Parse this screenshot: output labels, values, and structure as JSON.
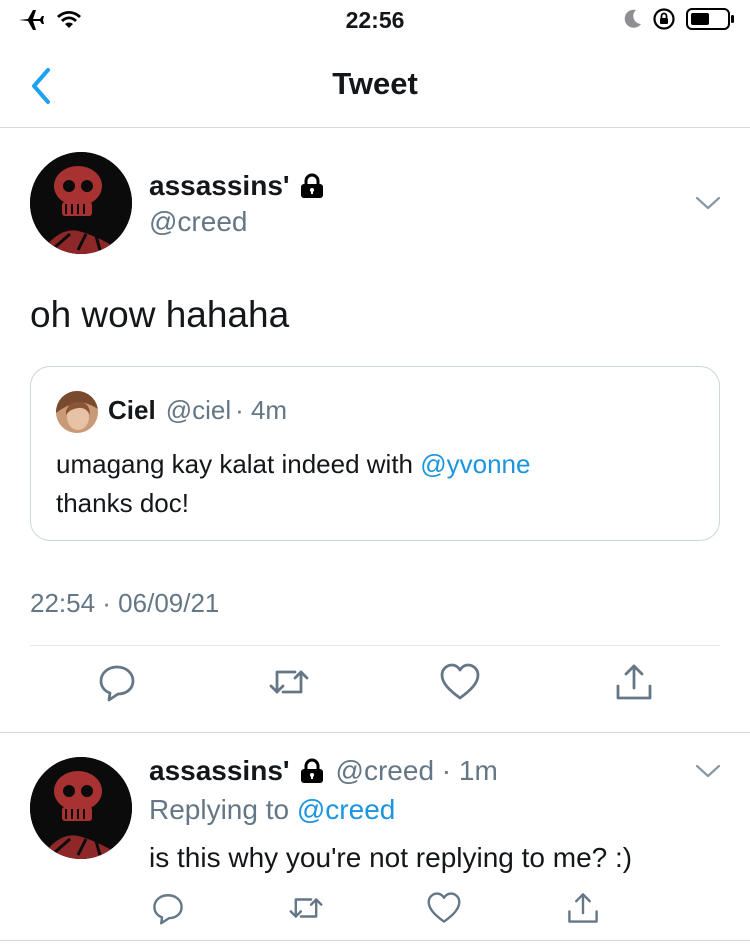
{
  "status_bar": {
    "time": "22:56"
  },
  "nav": {
    "title": "Tweet"
  },
  "main_tweet": {
    "display_name": "assassins'",
    "handle": "@creed",
    "text": "oh wow hahaha",
    "timestamp": "22:54 · 06/09/21",
    "quote": {
      "display_name": "Ciel",
      "handle": "@ciel",
      "time": "· 4m",
      "text_before": "umagang kay kalat indeed with ",
      "mention": "@yvonne",
      "text_after": "thanks doc!"
    }
  },
  "reply_tweet": {
    "display_name": "assassins'",
    "handle_time": "@creed · 1m",
    "replying_label": "Replying to ",
    "replying_handle": "@creed",
    "text": "is this why you're not replying to me? :)"
  },
  "icons": [
    "airplane-icon",
    "wifi-icon",
    "moon-icon",
    "rotation-lock-icon",
    "battery-icon",
    "back-icon",
    "lock-icon",
    "chevron-down-icon",
    "reply-icon",
    "retweet-icon",
    "like-icon",
    "share-icon"
  ],
  "colors": {
    "link": "#1b95e0",
    "back": "#1da1f2",
    "secondary_text": "#657786",
    "avatar_red": "#a83232"
  }
}
